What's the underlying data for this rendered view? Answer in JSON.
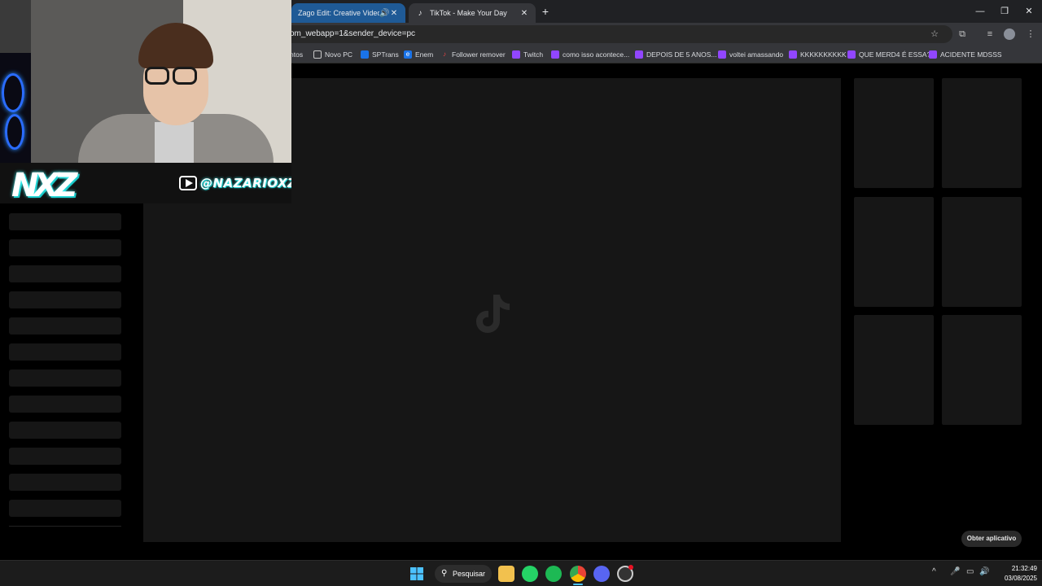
{
  "tabs": [
    {
      "title": "Zago Edit: Creative Video S",
      "active": false,
      "audio": true
    },
    {
      "title": "TikTok - Make Your Day",
      "active": true
    }
  ],
  "address_bar": {
    "url": "om_webapp=1&sender_device=pc"
  },
  "bookmarks": [
    {
      "label": "ntos",
      "icon": "none"
    },
    {
      "label": "Novo PC",
      "icon": "folder-icon"
    },
    {
      "label": "SPTrans",
      "icon": "sptrans-icon"
    },
    {
      "label": "Enem",
      "icon": "enem-icon"
    },
    {
      "label": "Follower remover",
      "icon": "tiktok-icon"
    },
    {
      "label": "Twitch",
      "icon": "twitch-icon"
    },
    {
      "label": "como isso acontece...",
      "icon": "twitch-icon"
    },
    {
      "label": "DEPOIS DE 5 ANOS...",
      "icon": "twitch-icon"
    },
    {
      "label": "voltei amassando",
      "icon": "twitch-icon"
    },
    {
      "label": "KKKKKKKKKK",
      "icon": "twitch-icon"
    },
    {
      "label": "QUE MERD4 É ESSA?",
      "icon": "twitch-icon"
    },
    {
      "label": "ACIDENTE MDSSS",
      "icon": "twitch-icon"
    }
  ],
  "page": {
    "get_app_label": "Obter aplicativo"
  },
  "overlay": {
    "logo_text": "NXZ",
    "handle": "@NAZARIOXZ"
  },
  "taskbar": {
    "search_label": "Pesquisar",
    "time": "21:32:49",
    "date": "03/08/2025",
    "apps": [
      "windows-start-icon",
      "file-explorer-icon",
      "whatsapp-icon",
      "spotify-icon",
      "chrome-icon",
      "discord-icon",
      "obs-icon"
    ]
  },
  "colors": {
    "accent_tab": "#1f5a96",
    "twitch": "#9146ff",
    "spotify": "#1db954",
    "whatsapp": "#25d366",
    "discord": "#5865f2"
  }
}
